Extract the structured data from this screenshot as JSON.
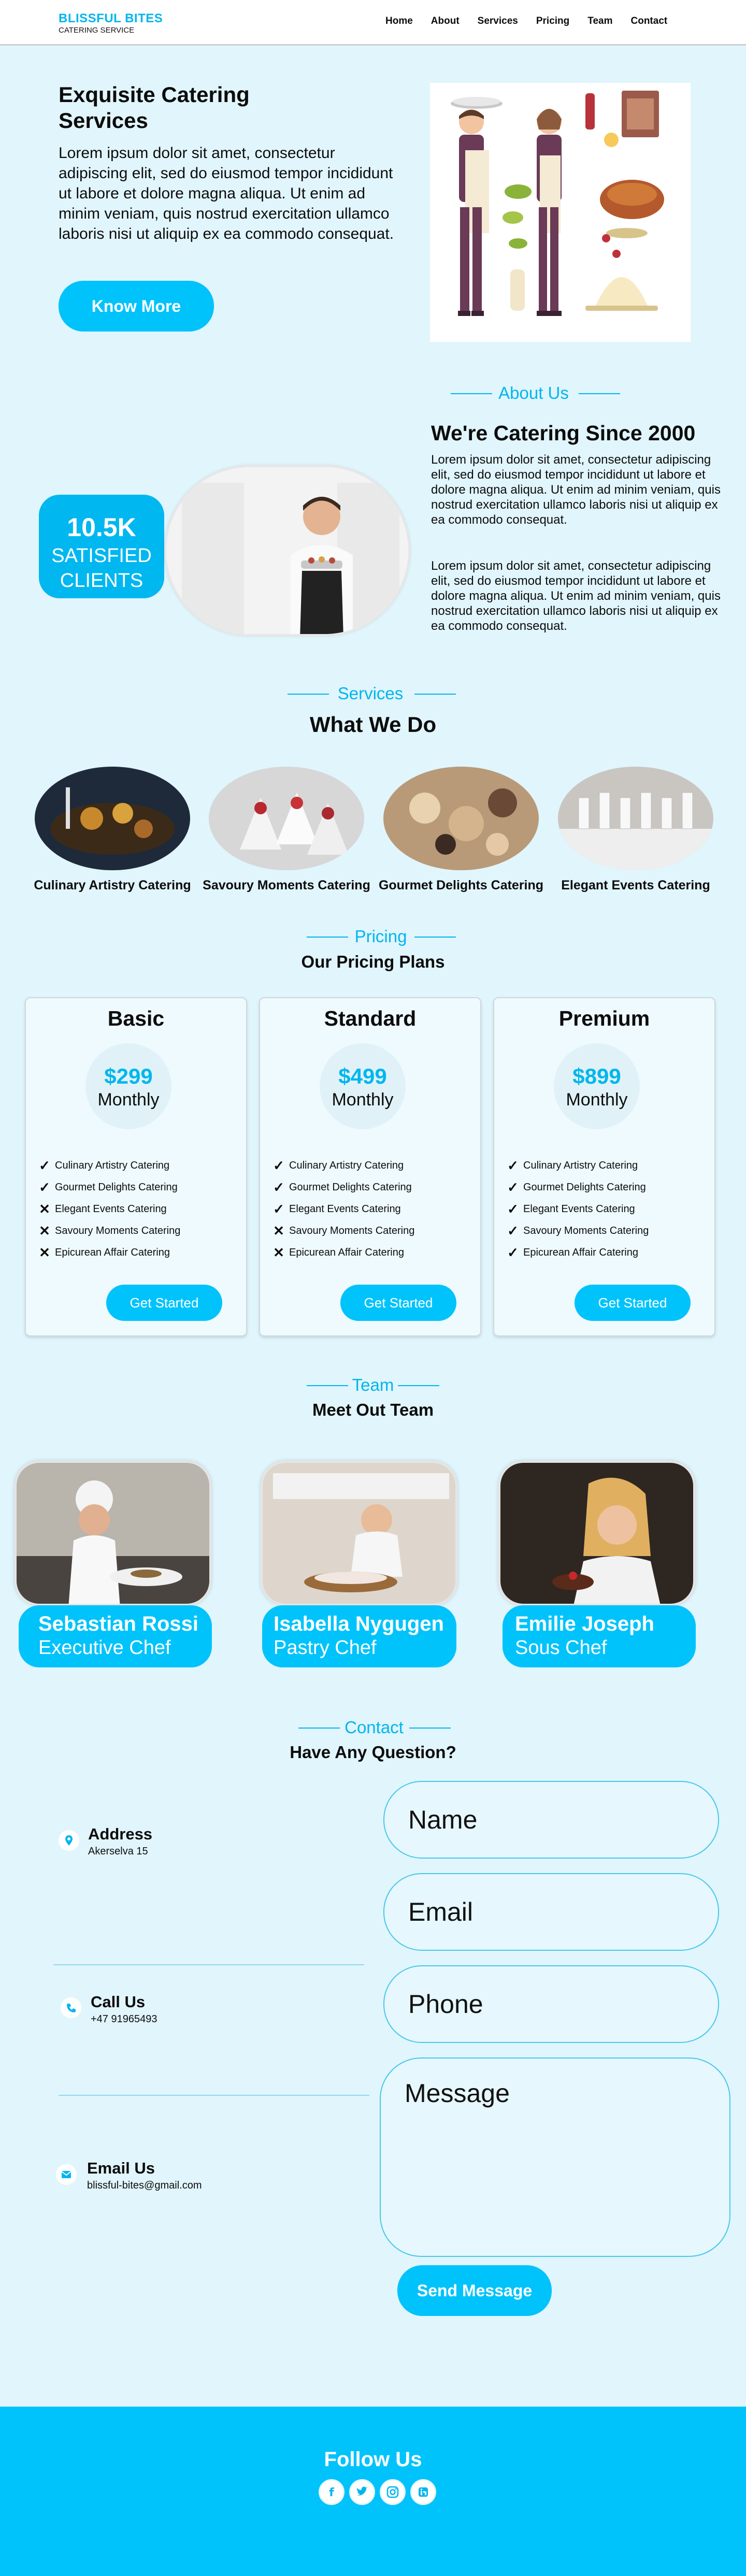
{
  "nav": {
    "brand": "BLISSFUL BITES",
    "sub": "CATERING SERVICE",
    "links": [
      "Home",
      "About",
      "Services",
      "Pricing",
      "Team",
      "Contact"
    ]
  },
  "hero": {
    "title": "Exquisite Catering Services",
    "body": "Lorem ipsum dolor sit amet, consectetur adipiscing elit, sed do eiusmod tempor incididunt ut labore et dolore magna aliqua. Ut enim ad minim veniam, quis nostrud exercitation ullamco laboris nisi ut aliquip ex ea commodo consequat.",
    "button": "Know More"
  },
  "about": {
    "label": "About Us",
    "heading": "We're Catering Since 2000",
    "p1": "Lorem ipsum dolor sit amet, consectetur adipiscing elit, sed do eiusmod tempor incididunt ut labore et dolore magna aliqua. Ut enim ad minim veniam, quis nostrud exercitation ullamco laboris nisi ut aliquip ex ea commodo consequat.",
    "p2": "Lorem ipsum dolor sit amet, consectetur adipiscing elit, sed do eiusmod tempor incididunt ut labore et dolore magna aliqua. Ut enim ad minim veniam, quis nostrud exercitation ullamco laboris nisi ut aliquip ex ea commodo consequat.",
    "badge_num": "10.5K",
    "badge_l1": "SATISFIED",
    "badge_l2": "CLIENTS"
  },
  "services": {
    "label": "Services",
    "heading": "What We Do",
    "items": [
      "Culinary Artistry Catering",
      "Savoury Moments Catering",
      "Gourmet Delights Catering",
      "Elegant Events Catering"
    ]
  },
  "pricing": {
    "label": "Pricing",
    "heading": "Our Pricing Plans",
    "button": "Get Started",
    "plans": [
      {
        "name": "Basic",
        "price": "$299",
        "period": "Monthly",
        "features": [
          "Culinary Artistry Catering",
          "Gourmet Delights Catering",
          "Elegant Events Catering",
          "Savoury Moments Catering",
          "Epicurean Affair Catering"
        ],
        "marks": [
          "✓",
          "✓",
          "✕",
          "✕",
          "✕"
        ]
      },
      {
        "name": "Standard",
        "price": "$499",
        "period": "Monthly",
        "features": [
          "Culinary Artistry Catering",
          "Gourmet Delights Catering",
          "Elegant Events Catering",
          "Savoury Moments Catering",
          "Epicurean Affair Catering"
        ],
        "marks": [
          "✓",
          "✓",
          "✓",
          "✕",
          "✕"
        ]
      },
      {
        "name": "Premium",
        "price": "$899",
        "period": "Monthly",
        "features": [
          "Culinary Artistry Catering",
          "Gourmet Delights Catering",
          "Elegant Events Catering",
          "Savoury Moments Catering",
          "Epicurean Affair Catering"
        ],
        "marks": [
          "✓",
          "✓",
          "✓",
          "✓",
          "✓"
        ]
      }
    ]
  },
  "team": {
    "label": "Team",
    "heading": "Meet Out Team",
    "members": [
      {
        "name": "Sebastian Rossi",
        "role": "Executive Chef"
      },
      {
        "name": "Isabella Nygugen",
        "role": "Pastry Chef"
      },
      {
        "name": "Emilie Joseph",
        "role": "Sous Chef"
      }
    ]
  },
  "contact": {
    "label": "Contact",
    "heading": "Have Any Question?",
    "address_h": "Address",
    "address_v": "Akerselva 15",
    "call_h": "Call Us",
    "call_v": "+47 91965493",
    "email_h": "Email Us",
    "email_v": "blissful-bites@gmail.com",
    "ph_name": "Name",
    "ph_email": "Email",
    "ph_phone": "Phone",
    "ph_message": "Message",
    "button": "Send Message"
  },
  "footer": {
    "heading": "Follow Us",
    "icons": [
      "facebook-icon",
      "twitter-icon",
      "instagram-icon",
      "linkedin-icon"
    ]
  },
  "colors": {
    "accent": "#00c3fb",
    "bg": "#e1f5fc"
  }
}
